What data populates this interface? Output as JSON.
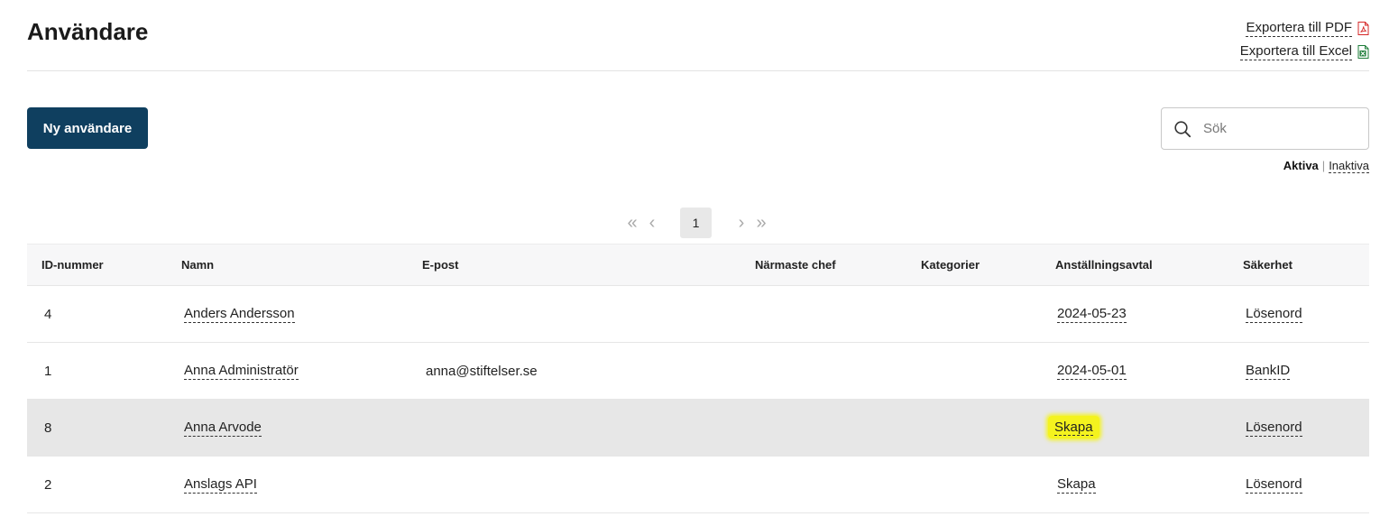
{
  "page": {
    "title": "Användare"
  },
  "exports": {
    "pdf_label": "Exportera till PDF",
    "excel_label": "Exportera till Excel",
    "pdf_color": "#d62828",
    "excel_color": "#1e7d3a"
  },
  "toolbar": {
    "new_user_label": "Ny användare",
    "button_color": "#0f3f5f",
    "search_placeholder": "Sök"
  },
  "filter": {
    "active_label": "Aktiva",
    "separator": "|",
    "inactive_label": "Inaktiva"
  },
  "pagination": {
    "current_page": "1"
  },
  "table": {
    "headers": {
      "id": "ID-nummer",
      "name": "Namn",
      "email": "E-post",
      "chief": "Närmaste chef",
      "categories": "Kategorier",
      "contract": "Anställningsavtal",
      "security": "Säkerhet"
    },
    "rows": [
      {
        "id": "4",
        "name": "Anders Andersson",
        "email": "",
        "chief": "",
        "categories": "",
        "contract": "2024-05-23",
        "security": "Lösenord"
      },
      {
        "id": "1",
        "name": "Anna Administratör",
        "email": "anna@stiftelser.se",
        "chief": "",
        "categories": "",
        "contract": "2024-05-01",
        "security": "BankID"
      },
      {
        "id": "8",
        "name": "Anna Arvode",
        "email": "",
        "chief": "",
        "categories": "",
        "contract": "Skapa",
        "security": "Lösenord"
      },
      {
        "id": "2",
        "name": "Anslags API",
        "email": "",
        "chief": "",
        "categories": "",
        "contract": "Skapa",
        "security": "Lösenord"
      }
    ],
    "highlight_color": "#f4f31e"
  }
}
